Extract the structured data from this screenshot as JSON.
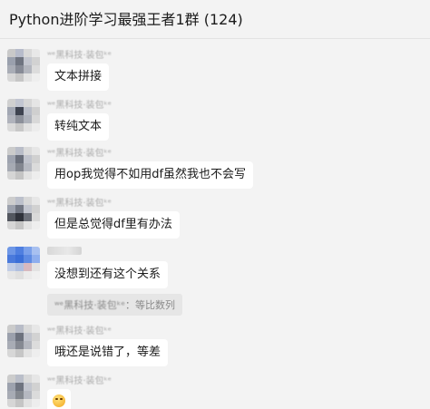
{
  "window": {
    "title": "Python进阶学习最强王者1群 (124)"
  },
  "messages": [
    {
      "sender": "ʷᵉ黑科技·装包ᵏᵉ",
      "text": "文本拼接"
    },
    {
      "sender": "ʷᵉ黑科技·装包ᵏᵉ",
      "text": "转纯文本"
    },
    {
      "sender": "ʷᵉ黑科技·装包ᵏᵉ",
      "text": "用op我觉得不如用df虽然我也不会写"
    },
    {
      "sender": "ʷᵉ黑科技·装包ᵏᵉ",
      "text": "但是总觉得df里有办法"
    },
    {
      "sender": "",
      "text": "没想到还有这个关系"
    },
    {
      "sender": "ʷᵉ黑科技·装包ᵏᵉ",
      "text": "哦还是说错了，等差"
    },
    {
      "sender": "ʷᵉ黑科技·装包ᵏᵉ",
      "text": ""
    }
  ],
  "quote": {
    "name": "ʷᵉ黑科技·装包ᵏᵉ",
    "text": "：等比数列"
  },
  "icons": {
    "emoji": "grimace-emoji-icon"
  }
}
